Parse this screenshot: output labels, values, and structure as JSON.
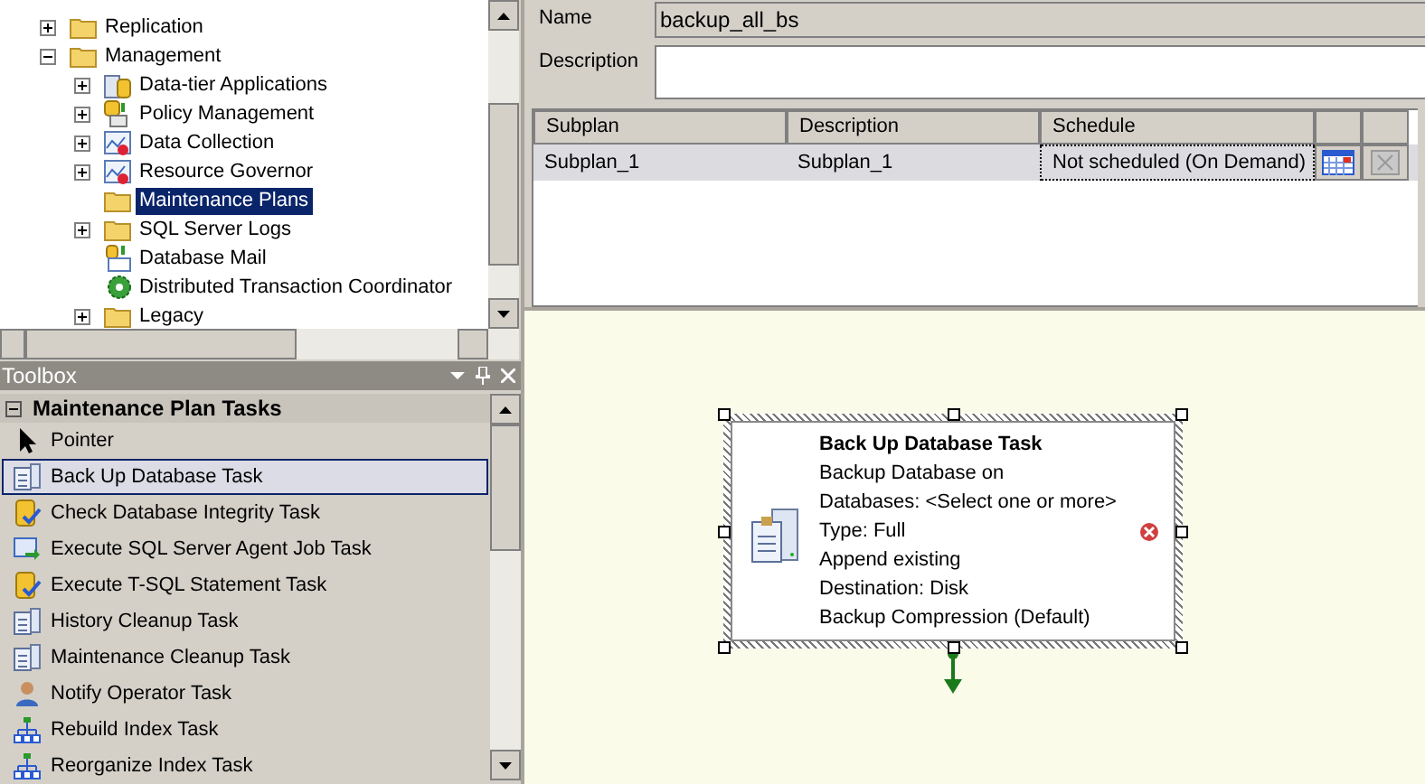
{
  "tree": [
    {
      "label": "Replication",
      "kind": "folder",
      "expanded": false,
      "selected": false
    },
    {
      "label": "Management",
      "kind": "folder",
      "expanded": true,
      "selected": false,
      "children": [
        {
          "label": "Data-tier Applications",
          "kind": "app",
          "expanded": false,
          "selected": false
        },
        {
          "label": "Policy Management",
          "kind": "policy",
          "expanded": false,
          "selected": false
        },
        {
          "label": "Data Collection",
          "kind": "chart",
          "expanded": false,
          "selected": false
        },
        {
          "label": "Resource Governor",
          "kind": "chart",
          "expanded": false,
          "selected": false
        },
        {
          "label": "Maintenance Plans",
          "kind": "folder",
          "selected": true
        },
        {
          "label": "SQL Server Logs",
          "kind": "folder",
          "expanded": false,
          "selected": false
        },
        {
          "label": "Database Mail",
          "kind": "mail",
          "selected": false
        },
        {
          "label": "Distributed Transaction Coordinator",
          "kind": "gear",
          "selected": false
        },
        {
          "label": "Legacy",
          "kind": "folder",
          "expanded": false,
          "selected": false
        }
      ]
    }
  ],
  "toolbox": {
    "title": "Toolbox",
    "section": {
      "label": "Maintenance Plan Tasks",
      "expanded": true
    },
    "items": [
      {
        "label": "Pointer",
        "kind": "pointer",
        "selected": false
      },
      {
        "label": "Back Up Database Task",
        "kind": "task",
        "selected": true
      },
      {
        "label": "Check Database Integrity Task",
        "kind": "check",
        "selected": false
      },
      {
        "label": "Execute SQL Server Agent Job Task",
        "kind": "run",
        "selected": false
      },
      {
        "label": "Execute T-SQL Statement Task",
        "kind": "check",
        "selected": false
      },
      {
        "label": "History Cleanup Task",
        "kind": "task",
        "selected": false
      },
      {
        "label": "Maintenance Cleanup Task",
        "kind": "task",
        "selected": false
      },
      {
        "label": "Notify Operator Task",
        "kind": "person",
        "selected": false
      },
      {
        "label": "Rebuild Index Task",
        "kind": "index",
        "selected": false
      },
      {
        "label": "Reorganize Index Task",
        "kind": "index",
        "selected": false
      }
    ]
  },
  "properties": {
    "name_label": "Name",
    "name_value": "backup_all_bs",
    "description_label": "Description"
  },
  "subplans": {
    "columns": [
      "Subplan",
      "Description",
      "Schedule"
    ],
    "rows": [
      {
        "subplan": "Subplan_1",
        "description": "Subplan_1",
        "schedule": "Not scheduled (On Demand)",
        "selected": true
      }
    ]
  },
  "task": {
    "title": "Back Up Database Task",
    "lines": [
      "Backup Database on",
      "Databases: <Select one or more>",
      "Type: Full",
      "Append existing",
      "Destination: Disk",
      "Backup Compression (Default)"
    ],
    "error": true,
    "selected": true
  }
}
